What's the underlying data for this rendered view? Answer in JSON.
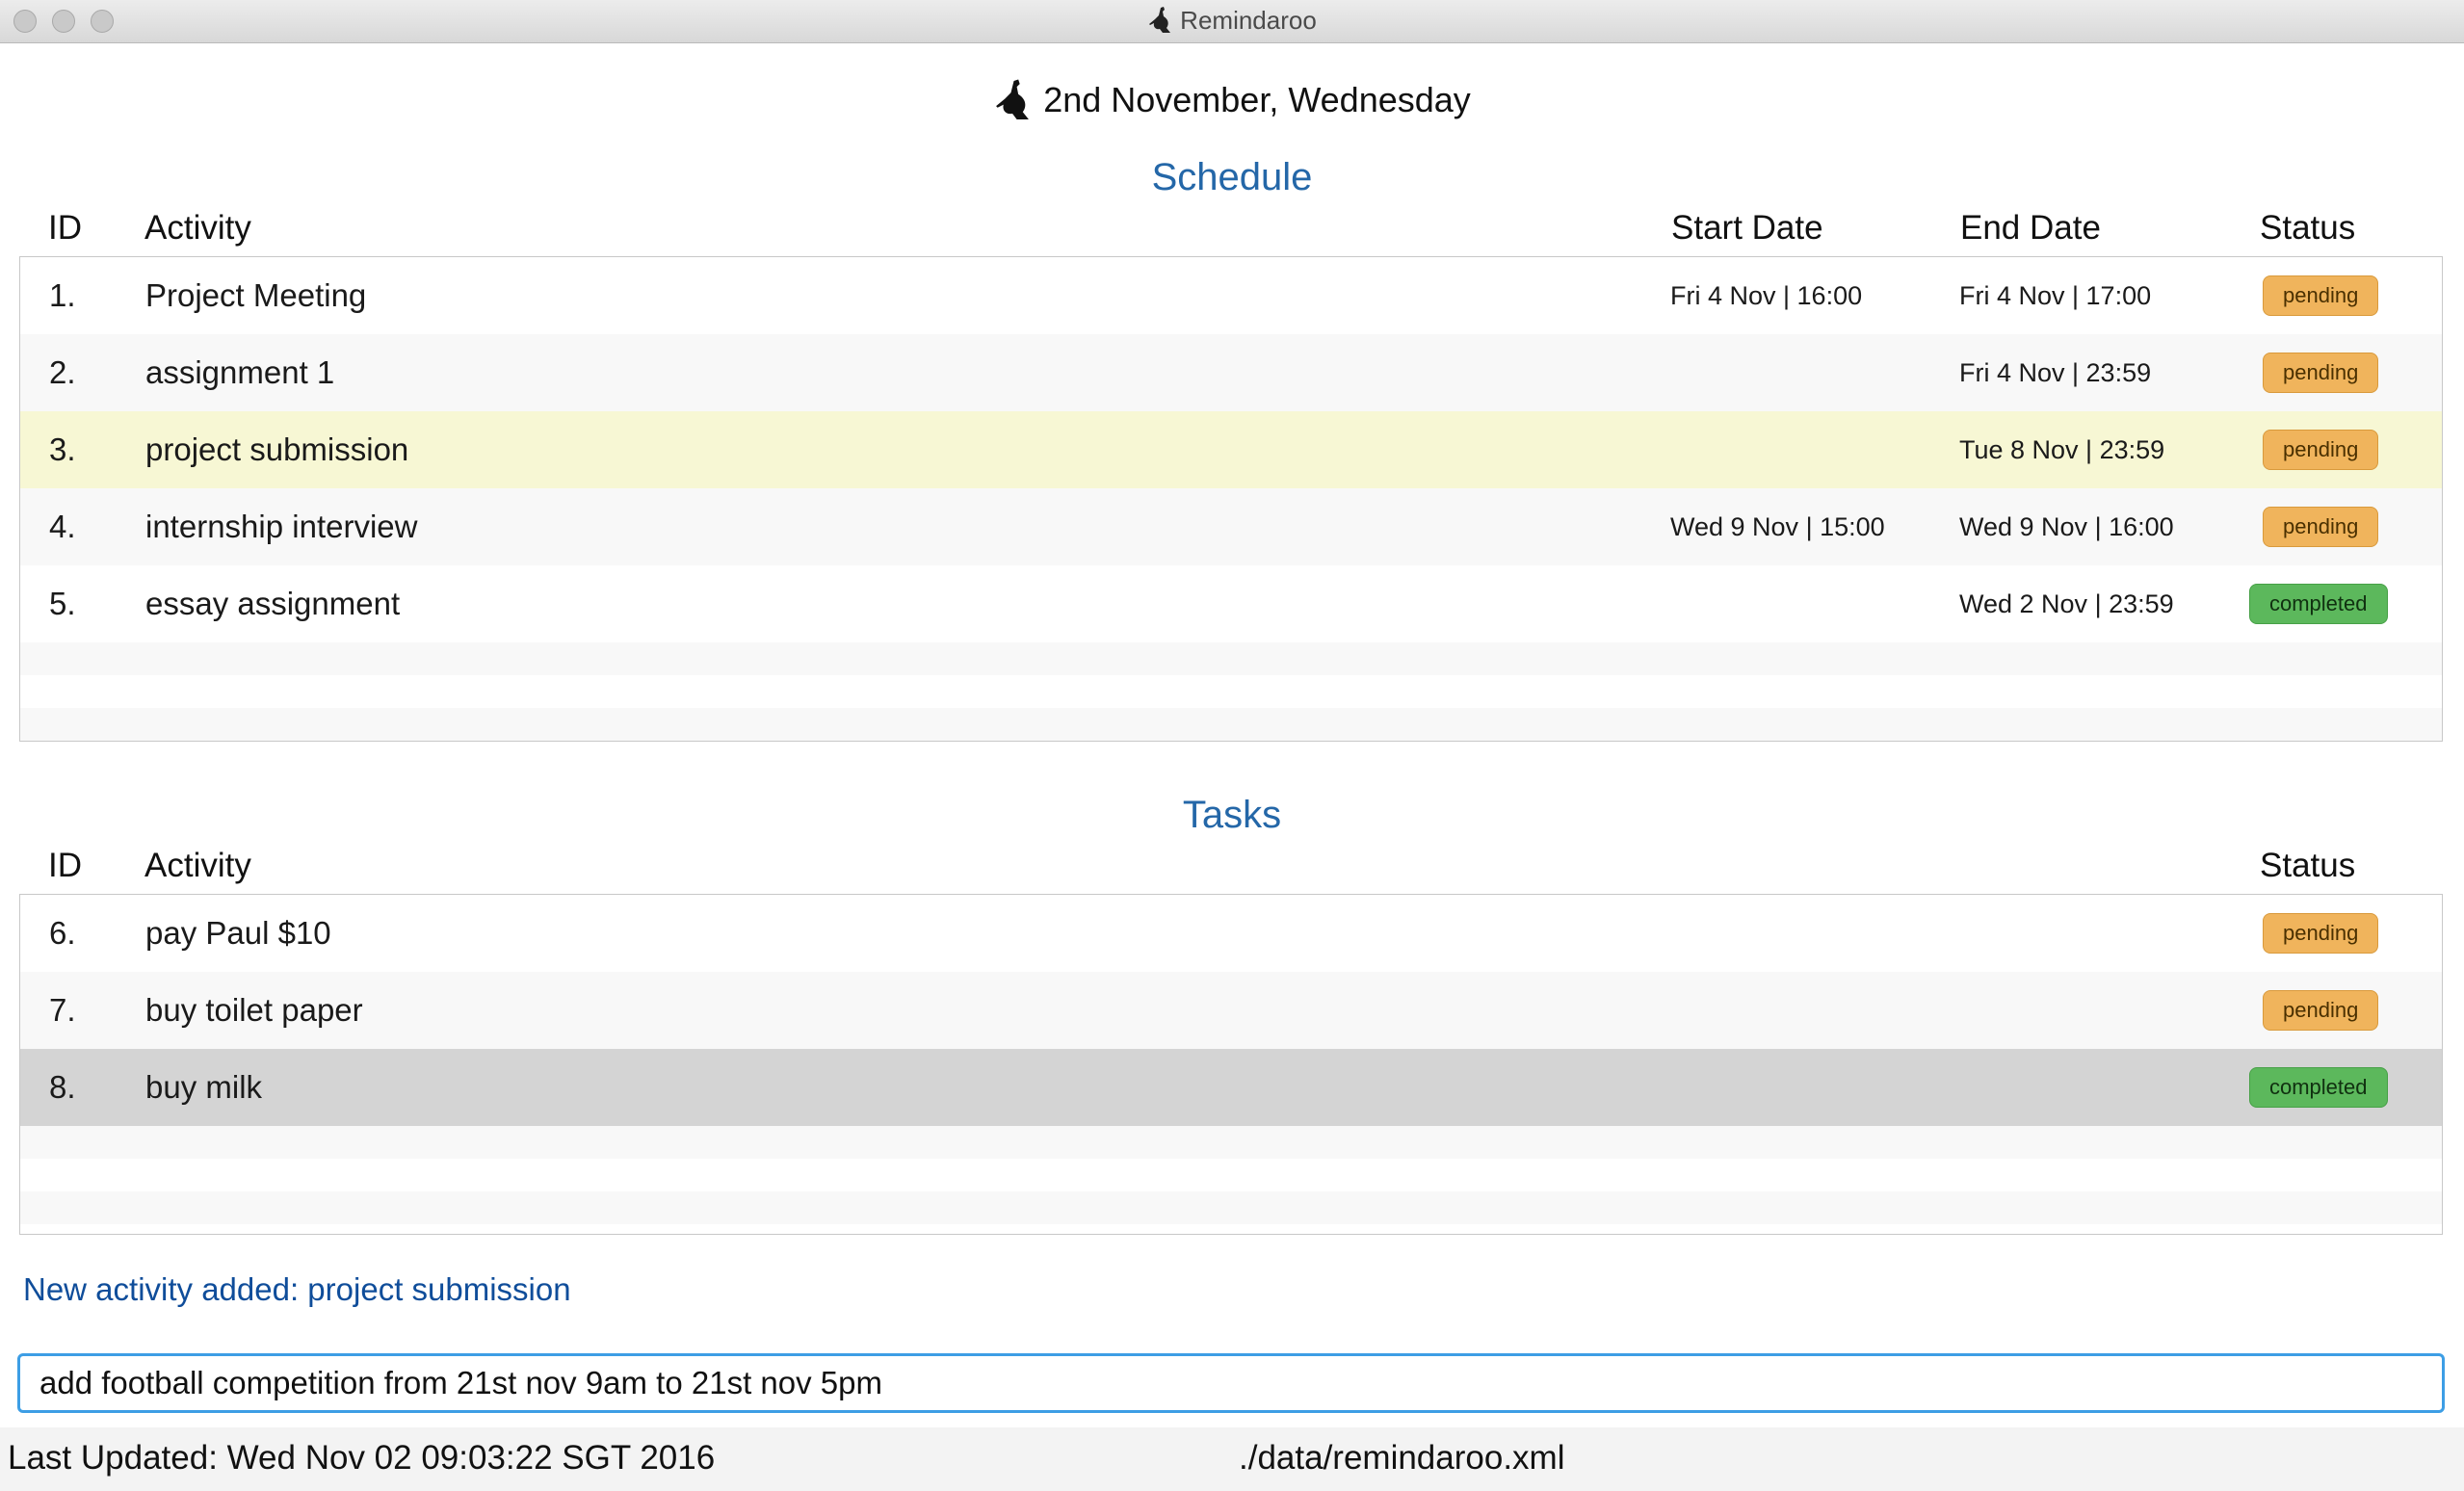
{
  "window": {
    "title": "Remindaroo"
  },
  "header": {
    "date": "2nd November, Wednesday"
  },
  "schedule": {
    "title": "Schedule",
    "columns": {
      "id": "ID",
      "activity": "Activity",
      "start": "Start Date",
      "end": "End Date",
      "status": "Status"
    },
    "rows": [
      {
        "id": "1.",
        "activity": "Project Meeting",
        "start": "Fri 4 Nov | 16:00",
        "end": "Fri 4 Nov | 17:00",
        "status": "pending"
      },
      {
        "id": "2.",
        "activity": "assignment 1",
        "start": "",
        "end": "Fri 4 Nov | 23:59",
        "status": "pending"
      },
      {
        "id": "3.",
        "activity": "project submission",
        "start": "",
        "end": "Tue 8 Nov | 23:59",
        "status": "pending"
      },
      {
        "id": "4.",
        "activity": "internship interview",
        "start": "Wed 9 Nov | 15:00",
        "end": "Wed 9 Nov | 16:00",
        "status": "pending"
      },
      {
        "id": "5.",
        "activity": "essay assignment",
        "start": "",
        "end": "Wed 2 Nov | 23:59",
        "status": "completed"
      }
    ]
  },
  "tasks": {
    "title": "Tasks",
    "columns": {
      "id": "ID",
      "activity": "Activity",
      "status": "Status"
    },
    "rows": [
      {
        "id": "6.",
        "activity": "pay Paul $10",
        "status": "pending"
      },
      {
        "id": "7.",
        "activity": "buy toilet paper",
        "status": "pending"
      },
      {
        "id": "8.",
        "activity": "buy milk",
        "status": "completed"
      }
    ]
  },
  "feedback": "New activity added: project submission",
  "command": {
    "value": "add football competition from 21st nov 9am to 21st nov 5pm"
  },
  "statusbar": {
    "last_updated": "Last Updated: Wed Nov 02 09:03:22 SGT 2016",
    "file_path": "./data/remindaroo.xml"
  },
  "colors": {
    "accent": "#2467a8",
    "pending": "#f0b45c",
    "completed": "#5cb85c",
    "highlight_row": "#f7f7d4",
    "selected_row": "#d4d4d4"
  }
}
